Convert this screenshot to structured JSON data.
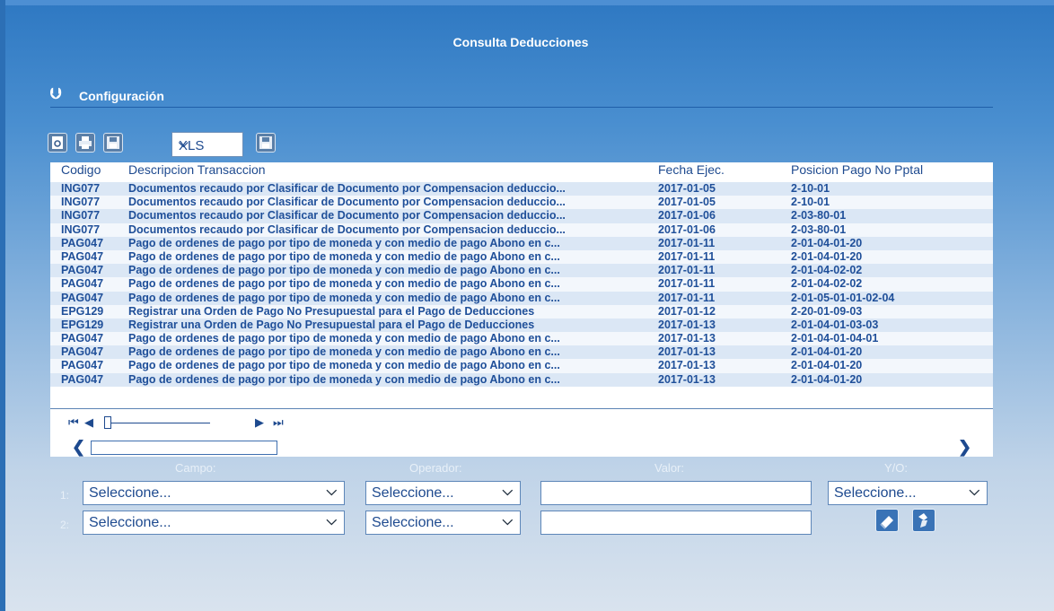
{
  "title": "Consulta Deducciones",
  "config": {
    "label": "Configuración",
    "icon": "double-chevron-down-icon"
  },
  "toolbar": {
    "buttons": [
      "refresh-icon",
      "print-icon",
      "save-icon",
      "export-icon"
    ],
    "format_value": "XLS"
  },
  "grid": {
    "columns": [
      "Codigo",
      "Descripcion Transaccion",
      "Fecha Ejec.",
      "Posicion Pago No Pptal"
    ],
    "rows": [
      [
        "ING077",
        "Documentos recaudo por Clasificar de Documento por Compensacion deduccio...",
        "2017-01-05",
        "2-10-01"
      ],
      [
        "ING077",
        "Documentos recaudo por Clasificar de Documento por Compensacion deduccio...",
        "2017-01-05",
        "2-10-01"
      ],
      [
        "ING077",
        "Documentos recaudo por Clasificar de Documento por Compensacion deduccio...",
        "2017-01-06",
        "2-03-80-01"
      ],
      [
        "ING077",
        "Documentos recaudo por Clasificar de Documento por Compensacion deduccio...",
        "2017-01-06",
        "2-03-80-01"
      ],
      [
        "PAG047",
        "Pago de ordenes de pago por tipo de moneda y con medio de pago Abono en c...",
        "2017-01-11",
        "2-01-04-01-20"
      ],
      [
        "PAG047",
        "Pago de ordenes de pago por tipo de moneda y con medio de pago Abono en c...",
        "2017-01-11",
        "2-01-04-01-20"
      ],
      [
        "PAG047",
        "Pago de ordenes de pago por tipo de moneda y con medio de pago Abono en c...",
        "2017-01-11",
        "2-01-04-02-02"
      ],
      [
        "PAG047",
        "Pago de ordenes de pago por tipo de moneda y con medio de pago Abono en c...",
        "2017-01-11",
        "2-01-04-02-02"
      ],
      [
        "PAG047",
        "Pago de ordenes de pago por tipo de moneda y con medio de pago Abono en c...",
        "2017-01-11",
        "2-01-05-01-01-02-04"
      ],
      [
        "EPG129",
        "Registrar una Orden de Pago No Presupuestal para el Pago de Deducciones",
        "2017-01-12",
        "2-20-01-09-03"
      ],
      [
        "EPG129",
        "Registrar una Orden de Pago No Presupuestal para el Pago de Deducciones",
        "2017-01-13",
        "2-01-04-01-03-03"
      ],
      [
        "PAG047",
        "Pago de ordenes de pago por tipo de moneda y con medio de pago Abono en c...",
        "2017-01-13",
        "2-01-04-01-04-01"
      ],
      [
        "PAG047",
        "Pago de ordenes de pago por tipo de moneda y con medio de pago Abono en c...",
        "2017-01-13",
        "2-01-04-01-20"
      ],
      [
        "PAG047",
        "Pago de ordenes de pago por tipo de moneda y con medio de pago Abono en c...",
        "2017-01-13",
        "2-01-04-01-20"
      ],
      [
        "PAG047",
        "Pago de ordenes de pago por tipo de moneda y con medio de pago Abono en c...",
        "2017-01-13",
        "2-01-04-01-20"
      ]
    ]
  },
  "pager": {
    "first": "◀◀",
    "prev": "◀",
    "next": "▶",
    "last": "▶▶"
  },
  "filter": {
    "headers": {
      "campo": "Campo:",
      "operador": "Operador:",
      "valor": "Valor:",
      "yo": "Y/O:"
    },
    "row1": {
      "num": "1:",
      "campo": "Seleccione...",
      "operador": "Seleccione...",
      "valor": "",
      "yo": "Seleccione..."
    },
    "row2": {
      "num": "2:",
      "campo": "Seleccione...",
      "operador": "Seleccione...",
      "valor": ""
    },
    "actions": [
      "clear-icon",
      "apply-filter-icon"
    ]
  }
}
